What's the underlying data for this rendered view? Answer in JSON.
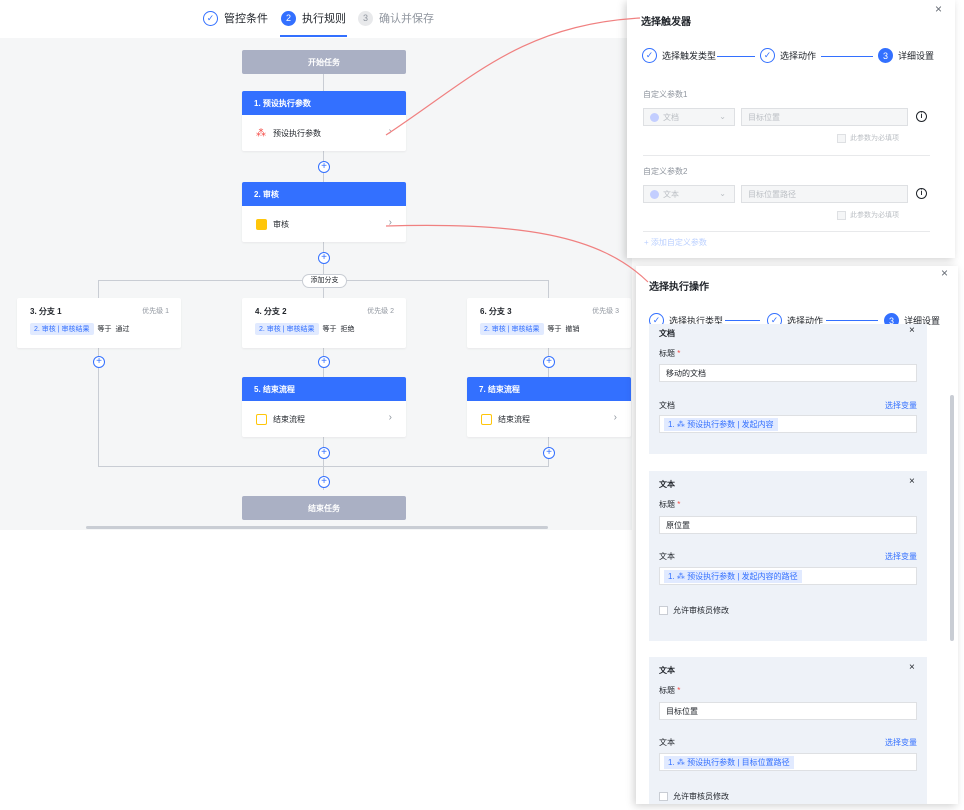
{
  "steps": [
    {
      "num": "✓",
      "label": "管控条件",
      "state": "done"
    },
    {
      "num": "2",
      "label": "执行规则",
      "state": "active"
    },
    {
      "num": "3",
      "label": "确认并保存",
      "state": "todo"
    }
  ],
  "flow": {
    "start": "开始任务",
    "end": "结束任务",
    "node1": {
      "title": "1. 预设执行参数",
      "body": "预设执行参数"
    },
    "node2": {
      "title": "2. 审核",
      "body": "审核"
    },
    "add_branch": "添加分支",
    "branches": [
      {
        "title": "3. 分支 1",
        "priority": "优先级 1",
        "tag": "2. 审核 | 审核结果",
        "op": "等于",
        "value": "通过"
      },
      {
        "title": "4. 分支 2",
        "priority": "优先级 2",
        "tag": "2. 审核 | 审核结果",
        "op": "等于",
        "value": "拒绝"
      },
      {
        "title": "6. 分支 3",
        "priority": "优先级 3",
        "tag": "2. 审核 | 审核结果",
        "op": "等于",
        "value": "撤销"
      }
    ],
    "node5": {
      "title": "5. 结束流程",
      "body": "结束流程"
    },
    "node7": {
      "title": "7. 结束流程",
      "body": "结束流程"
    },
    "plus": "+",
    "chevron": "›"
  },
  "trigger_panel": {
    "title": "选择触发器",
    "close": "×",
    "steps": [
      {
        "num": "✓",
        "label": "选择触发类型"
      },
      {
        "num": "✓",
        "label": "选择动作"
      },
      {
        "num": "3",
        "label": "详细设置"
      }
    ],
    "param1": {
      "label": "自定义参数1",
      "type": "文档",
      "placeholder": "目标位置",
      "required": "此参数为必填项"
    },
    "param2": {
      "label": "自定义参数2",
      "type": "文本",
      "placeholder": "目标位置路径",
      "required": "此参数为必填项"
    },
    "add_param": "+ 添加自定义参数",
    "info": "i",
    "dropdown": "⌄"
  },
  "action_panel": {
    "title": "选择执行操作",
    "close": "×",
    "steps": [
      {
        "num": "✓",
        "label": "选择执行类型"
      },
      {
        "num": "✓",
        "label": "选择动作"
      },
      {
        "num": "3",
        "label": "详细设置"
      }
    ],
    "cards": [
      {
        "title": "文档",
        "title_label": "标题",
        "title_value": "移动的文档",
        "var_label": "文档",
        "select_var": "选择变量",
        "var_value": "1. ⁂ 预设执行参数 | 发起内容",
        "allow": ""
      },
      {
        "title": "文本",
        "title_label": "标题",
        "title_value": "原位置",
        "var_label": "文本",
        "select_var": "选择变量",
        "var_value": "1. ⁂ 预设执行参数 | 发起内容的路径",
        "allow": "允许审核员修改"
      },
      {
        "title": "文本",
        "title_label": "标题",
        "title_value": "目标位置",
        "var_label": "文本",
        "select_var": "选择变量",
        "var_value": "1. ⁂ 预设执行参数 | 目标位置路径",
        "allow": "允许审核员修改"
      }
    ],
    "required_mark": "*",
    "card_close": "×"
  },
  "colors": {
    "accent": "#3370ff",
    "connector": "#f08080"
  }
}
